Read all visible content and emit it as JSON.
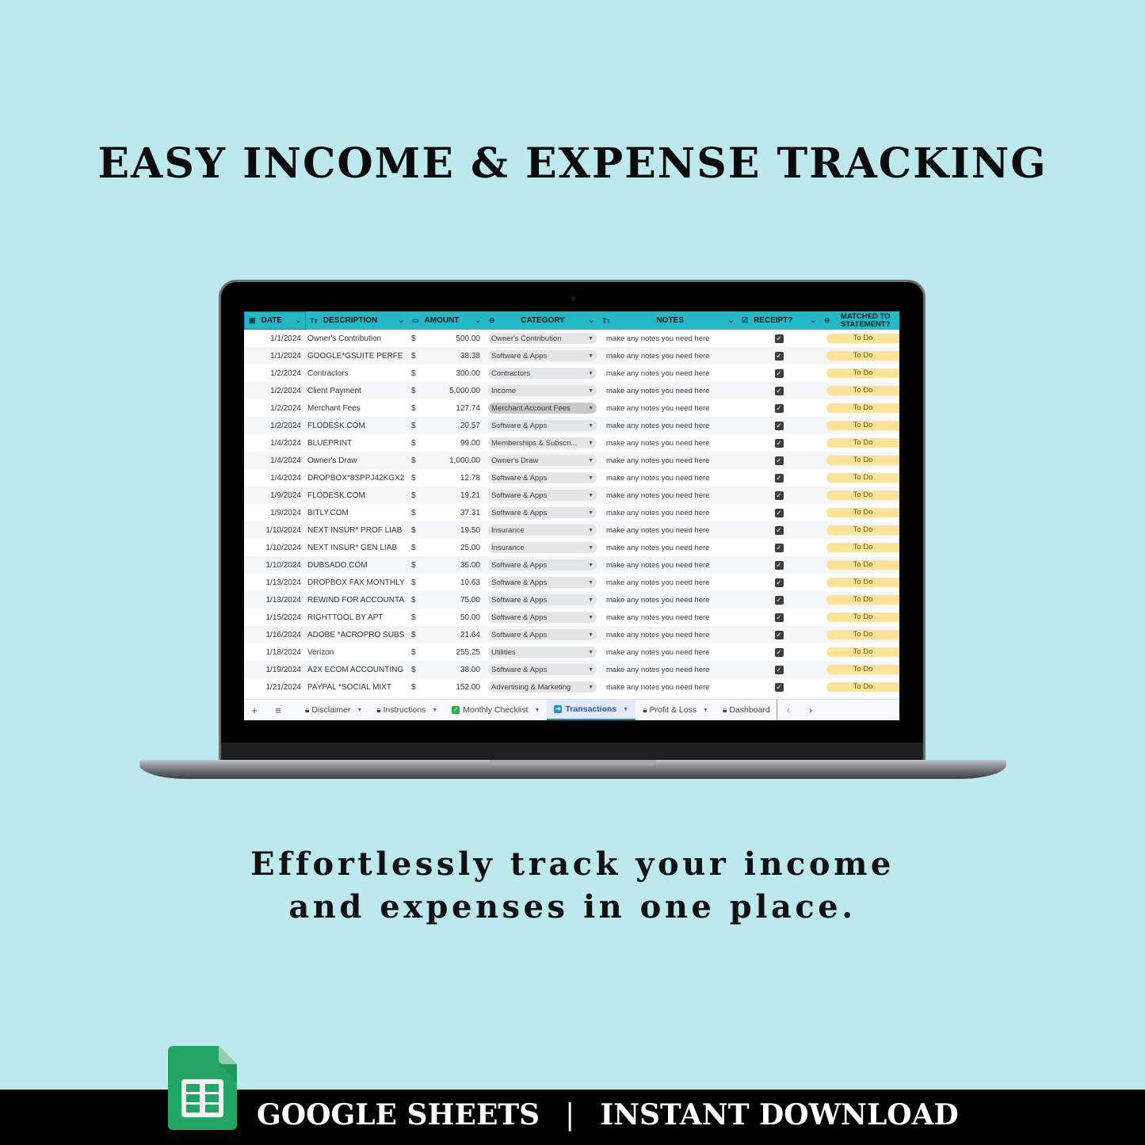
{
  "headline": "EASY INCOME & EXPENSE TRACKING",
  "tagline": {
    "line1": "Effortlessly track your income",
    "line2": "and expenses in one place."
  },
  "footer": {
    "left": "GOOGLE SHEETS",
    "separator": "|",
    "right": "INSTANT DOWNLOAD",
    "logo_icon": "google-sheets-icon"
  },
  "sheet": {
    "colors": {
      "header_bg": "#22b8c6",
      "todo_bg": "#fde39a",
      "active_tab_bg": "#e3eafd"
    },
    "columns": [
      {
        "key": "date",
        "label": "DATE",
        "icon": "calendar-icon"
      },
      {
        "key": "description",
        "label": "DESCRIPTION",
        "icon": "text-type-icon"
      },
      {
        "key": "amount",
        "label": "AMOUNT",
        "icon": "money-icon"
      },
      {
        "key": "category",
        "label": "CATEGORY",
        "icon": "dropdown-chip-icon"
      },
      {
        "key": "notes",
        "label": "NOTES",
        "icon": "text-type-icon"
      },
      {
        "key": "receipt",
        "label": "RECEIPT?",
        "icon": "checkbox-icon"
      },
      {
        "key": "matched",
        "label_line1": "MATCHED TO",
        "label_line2": "STATEMENT?",
        "icon": "dropdown-chip-icon"
      }
    ],
    "currency_symbol": "$",
    "rows": [
      {
        "date": "1/1/2024",
        "description": "Owner's Contribution",
        "amount": "500.00",
        "category": "Owner's Contribution",
        "notes": "make any notes you need here",
        "receipt": true,
        "matched": "To Do"
      },
      {
        "date": "1/1/2024",
        "description": "GOOGLE*GSUITE PERFE",
        "amount": "38.38",
        "category": "Software & Apps",
        "notes": "make any notes you need here",
        "receipt": true,
        "matched": "To Do"
      },
      {
        "date": "1/2/2024",
        "description": "Contractors",
        "amount": "300.00",
        "category": "Contractors",
        "notes": "make any notes you need here",
        "receipt": true,
        "matched": "To Do"
      },
      {
        "date": "1/2/2024",
        "description": "Client Payment",
        "amount": "5,000.00",
        "category": "Income",
        "notes": "make any notes you need here",
        "receipt": true,
        "matched": "To Do"
      },
      {
        "date": "1/2/2024",
        "description": "Merchant Fees",
        "amount": "127.74",
        "category": "Merchant Account Fees",
        "notes": "make any notes you need here",
        "receipt": true,
        "matched": "To Do",
        "selected": true
      },
      {
        "date": "1/2/2024",
        "description": "FLODESK.COM",
        "amount": "20.57",
        "category": "Software & Apps",
        "notes": "make any notes you need here",
        "receipt": true,
        "matched": "To Do"
      },
      {
        "date": "1/4/2024",
        "description": "BLUEPRINT",
        "amount": "99.00",
        "category": "Memberships & Subscri...",
        "notes": "make any notes you need here",
        "receipt": true,
        "matched": "To Do"
      },
      {
        "date": "1/4/2024",
        "description": "Owner's Draw",
        "amount": "1,000.00",
        "category": "Owner's Draw",
        "notes": "make any notes you need here",
        "receipt": true,
        "matched": "To Do"
      },
      {
        "date": "1/4/2024",
        "description": "DROPBOX*8SPPJ42KGX2",
        "amount": "12.78",
        "category": "Software & Apps",
        "notes": "make any notes you need here",
        "receipt": true,
        "matched": "To Do"
      },
      {
        "date": "1/9/2024",
        "description": "FLODESK.COM",
        "amount": "19.21",
        "category": "Software & Apps",
        "notes": "make any notes you need here",
        "receipt": true,
        "matched": "To Do"
      },
      {
        "date": "1/9/2024",
        "description": "BITLY.COM",
        "amount": "37.31",
        "category": "Software & Apps",
        "notes": "make any notes you need here",
        "receipt": true,
        "matched": "To Do"
      },
      {
        "date": "1/10/2024",
        "description": "NEXT INSUR* PROF LIAB",
        "amount": "19.50",
        "category": "Insurance",
        "notes": "make any notes you need here",
        "receipt": true,
        "matched": "To Do"
      },
      {
        "date": "1/10/2024",
        "description": "NEXT INSUR* GEN LIAB",
        "amount": "25.00",
        "category": "Insurance",
        "notes": "make any notes you need here",
        "receipt": true,
        "matched": "To Do"
      },
      {
        "date": "1/10/2024",
        "description": "DUBSADO.COM",
        "amount": "35.00",
        "category": "Software & Apps",
        "notes": "make any notes you need here",
        "receipt": true,
        "matched": "To Do"
      },
      {
        "date": "1/13/2024",
        "description": "DROPBOX FAX MONTHLY",
        "amount": "10.63",
        "category": "Software & Apps",
        "notes": "make any notes you need here",
        "receipt": true,
        "matched": "To Do"
      },
      {
        "date": "1/13/2024",
        "description": "REWIND FOR ACCOUNTA",
        "amount": "75.00",
        "category": "Software & Apps",
        "notes": "make any notes you need here",
        "receipt": true,
        "matched": "To Do"
      },
      {
        "date": "1/15/2024",
        "description": "RIGHTTOOL BY APT",
        "amount": "50.00",
        "category": "Software & Apps",
        "notes": "make any notes you need here",
        "receipt": true,
        "matched": "To Do"
      },
      {
        "date": "1/16/2024",
        "description": "ADOBE  *ACROPRO SUBS",
        "amount": "21.64",
        "category": "Software & Apps",
        "notes": "make any notes you need here",
        "receipt": true,
        "matched": "To Do"
      },
      {
        "date": "1/18/2024",
        "description": "Verizon",
        "amount": "255.25",
        "category": "Utilities",
        "notes": "make any notes you need here",
        "receipt": true,
        "matched": "To Do"
      },
      {
        "date": "1/19/2024",
        "description": "A2X ECOM ACCOUNTING",
        "amount": "38.00",
        "category": "Software & Apps",
        "notes": "make any notes you need here",
        "receipt": true,
        "matched": "To Do"
      },
      {
        "date": "1/21/2024",
        "description": "PAYPAL *SOCIAL MIXT",
        "amount": "152.00",
        "category": "Advertising & Marketing",
        "notes": "make any notes you need here",
        "receipt": true,
        "matched": "To Do"
      }
    ],
    "tabs": [
      {
        "label": "Disclaimer",
        "icon": "lock-icon",
        "active": false
      },
      {
        "label": "Instructions",
        "icon": "lock-icon",
        "active": false
      },
      {
        "label": "Monthly Checklist",
        "icon": "green-checkbox-icon",
        "active": false
      },
      {
        "label": "Transactions",
        "icon": "arrow-right-box-icon",
        "active": true
      },
      {
        "label": "Profit & Loss",
        "icon": "lock-icon",
        "active": false
      },
      {
        "label": "Dashboard",
        "icon": "lock-icon",
        "active": false
      }
    ],
    "tab_controls": {
      "add": "+",
      "menu": "≡",
      "prev": "‹",
      "next": "›"
    }
  }
}
